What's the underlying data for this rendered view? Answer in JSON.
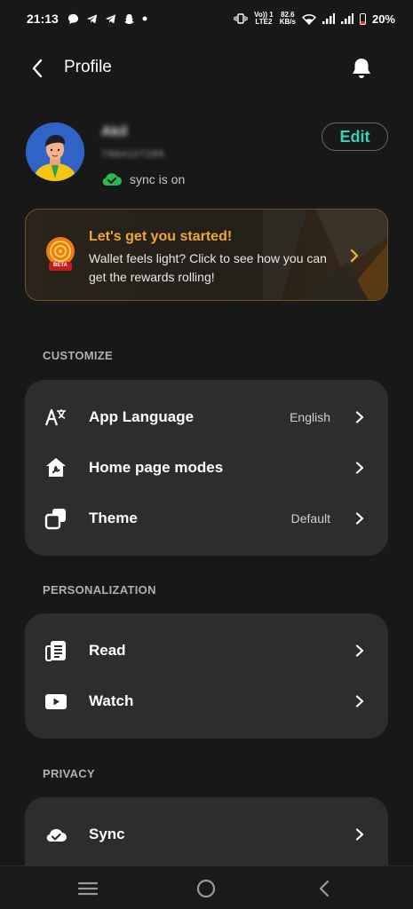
{
  "status_bar": {
    "time": "21:13",
    "volte_top": "Vo)) 1",
    "volte_bottom": "LTE2",
    "speed_top": "82.6",
    "speed_bottom": "KB/s",
    "battery": "20%"
  },
  "header": {
    "title": "Profile",
    "back_icon": "back-arrow-icon",
    "bell_icon": "bell-icon"
  },
  "profile": {
    "name": "Akil",
    "phone": "7984107289",
    "sync_text": "sync is on",
    "edit_label": "Edit",
    "sync_color": "#2db84a"
  },
  "promo": {
    "title": "Let's get you started!",
    "text": "Wallet feels light? Click to see how you can get the rewards rolling!",
    "badge": "BETA",
    "accent_color": "#f0a630"
  },
  "sections": {
    "customize": {
      "title": "CUSTOMIZE",
      "items": [
        {
          "label": "App Language",
          "value": "English",
          "icon": "language-icon"
        },
        {
          "label": "Home page modes",
          "value": "",
          "icon": "home-settings-icon"
        },
        {
          "label": "Theme",
          "value": "Default",
          "icon": "theme-icon"
        }
      ]
    },
    "personalization": {
      "title": "PERSONALIZATION",
      "items": [
        {
          "label": "Read",
          "icon": "read-icon"
        },
        {
          "label": "Watch",
          "icon": "watch-icon"
        }
      ]
    },
    "privacy": {
      "title": "PRIVACY",
      "items": [
        {
          "label": "Sync",
          "icon": "cloud-sync-icon"
        }
      ]
    }
  },
  "accent": {
    "edit_color": "#39d0b4"
  }
}
